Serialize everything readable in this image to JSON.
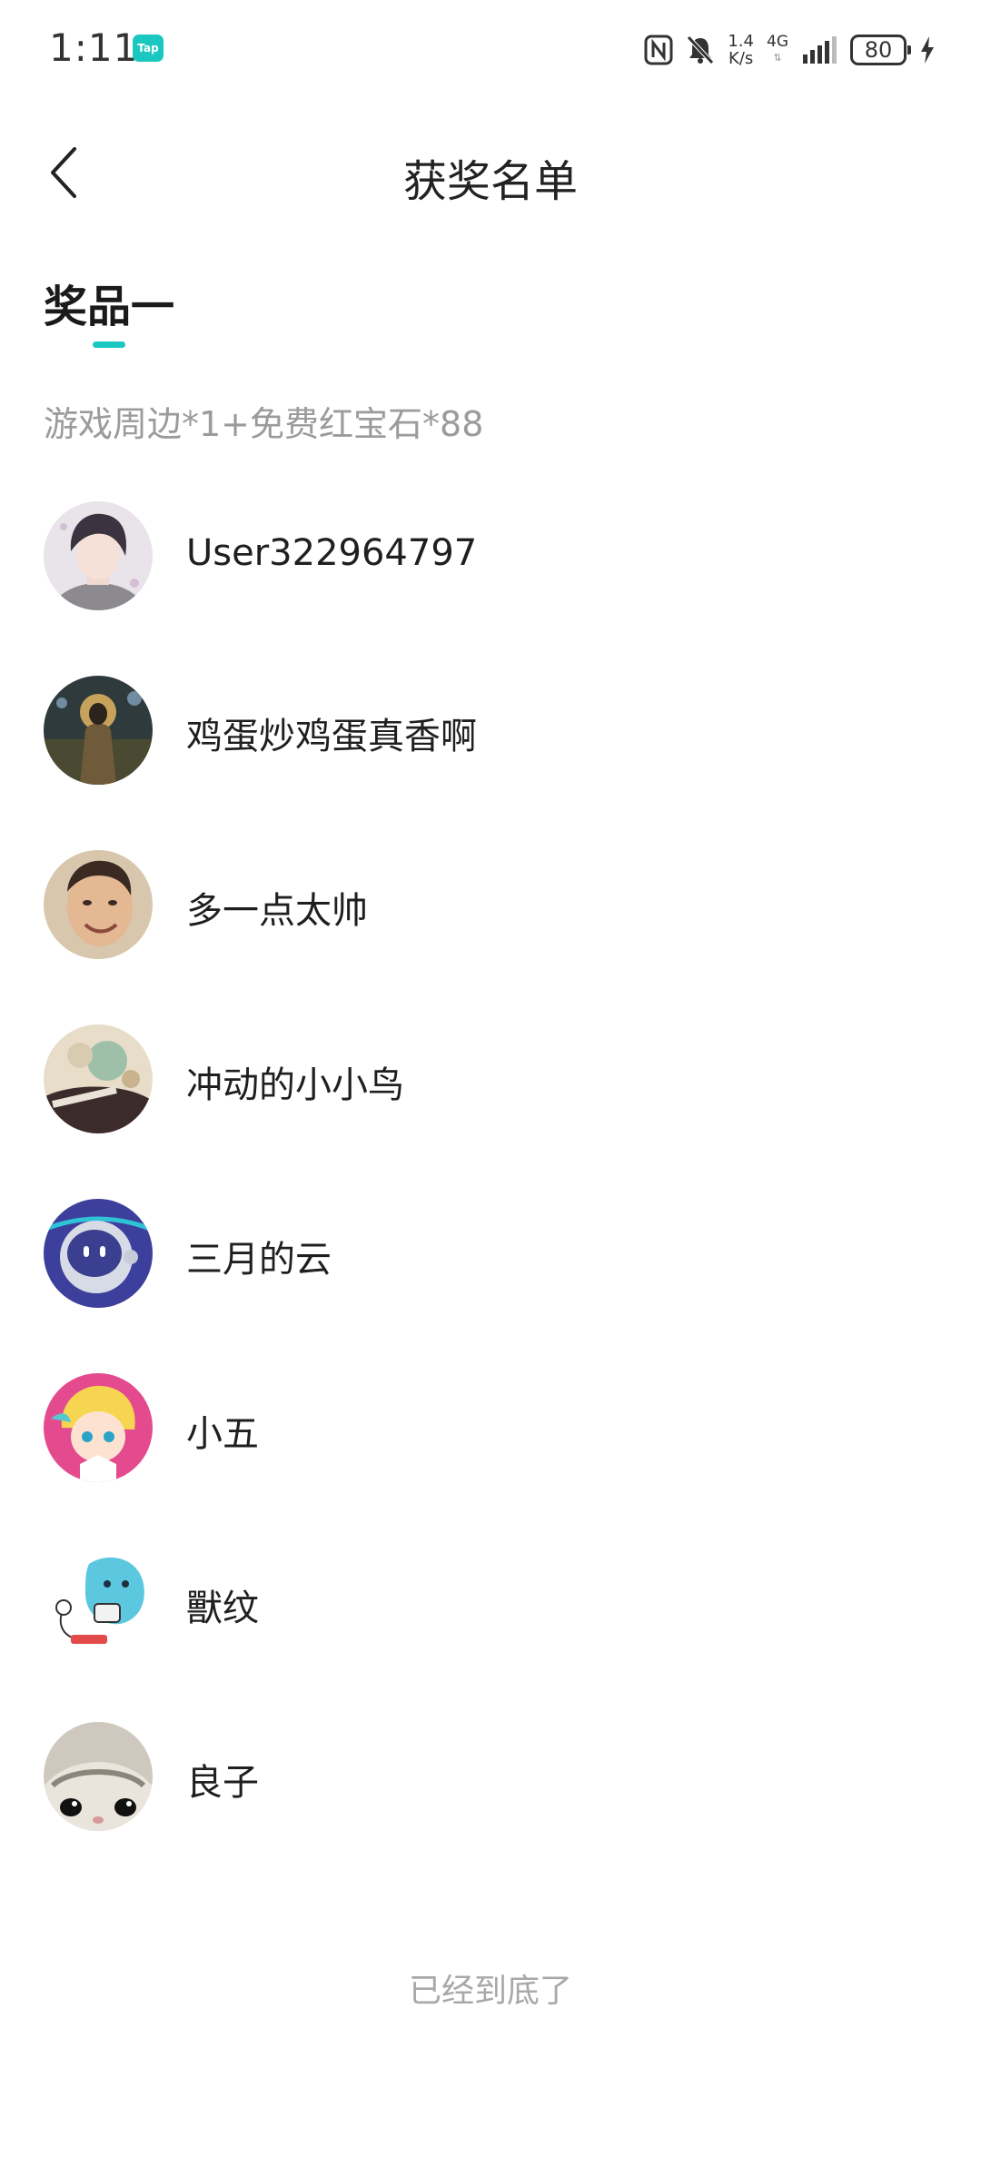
{
  "status_bar": {
    "time": "1:11",
    "app_badge": "Tap",
    "net_speed_value": "1.4",
    "net_speed_unit": "K/s",
    "net_type": "4G",
    "battery": "80"
  },
  "header": {
    "title": "获奖名单"
  },
  "prize": {
    "tab_label": "奖品一",
    "description": "游戏周边*1+免费红宝石*88"
  },
  "winners": [
    {
      "name": "User322964797"
    },
    {
      "name": "鸡蛋炒鸡蛋真香啊"
    },
    {
      "name": "多一点太帅"
    },
    {
      "name": "冲动的小小鸟"
    },
    {
      "name": "三月的云"
    },
    {
      "name": "小五"
    },
    {
      "name": "獸纹"
    },
    {
      "name": "良子"
    }
  ],
  "footer": {
    "end_text": "已经到底了"
  },
  "colors": {
    "accent": "#1bc8c1",
    "muted_text": "#9b9b9b"
  }
}
